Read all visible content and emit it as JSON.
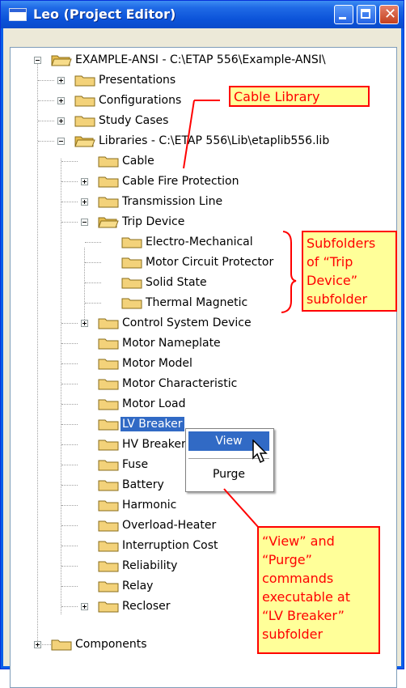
{
  "window": {
    "title": "Leo (Project Editor)",
    "buttons": [
      "minimize",
      "maximize",
      "close"
    ]
  },
  "tree": {
    "root": {
      "label": "EXAMPLE-ANSI - C:\\ETAP 556\\Example-ANSI\\",
      "expanded": true
    },
    "top_level": [
      {
        "label": "Presentations",
        "expanded": false
      },
      {
        "label": "Configurations",
        "expanded": false
      },
      {
        "label": "Study Cases",
        "expanded": false
      },
      {
        "label": "Libraries - C:\\ETAP 556\\Lib\\etaplib556.lib",
        "expanded": true
      },
      {
        "label": "Components",
        "expanded": false
      }
    ],
    "library_children": [
      {
        "label": "Cable",
        "expander": "none"
      },
      {
        "label": "Cable Fire Protection",
        "expander": "plus"
      },
      {
        "label": "Transmission Line",
        "expander": "plus"
      },
      {
        "label": "Trip Device",
        "expander": "minus"
      },
      {
        "label": "Control System Device",
        "expander": "plus"
      },
      {
        "label": "Motor Nameplate",
        "expander": "none"
      },
      {
        "label": "Motor Model",
        "expander": "none"
      },
      {
        "label": "Motor Characteristic",
        "expander": "none"
      },
      {
        "label": "Motor Load",
        "expander": "none"
      },
      {
        "label": "LV Breaker",
        "expander": "none",
        "selected": true
      },
      {
        "label": "HV Breaker",
        "expander": "none"
      },
      {
        "label": "Fuse",
        "expander": "none"
      },
      {
        "label": "Battery",
        "expander": "none"
      },
      {
        "label": "Harmonic",
        "expander": "none"
      },
      {
        "label": "Overload-Heater",
        "expander": "none"
      },
      {
        "label": "Interruption Cost",
        "expander": "none"
      },
      {
        "label": "Reliability",
        "expander": "none"
      },
      {
        "label": "Relay",
        "expander": "none"
      },
      {
        "label": "Recloser",
        "expander": "plus"
      }
    ],
    "trip_device_children": [
      {
        "label": "Electro-Mechanical"
      },
      {
        "label": "Motor Circuit Protector"
      },
      {
        "label": "Solid State"
      },
      {
        "label": "Thermal Magnetic"
      }
    ]
  },
  "context_menu": {
    "items": [
      {
        "label": "View",
        "highlighted": true
      },
      {
        "label": "Purge",
        "highlighted": false
      }
    ]
  },
  "callouts": {
    "cable_library": "Cable Library",
    "subfolders": [
      "Subfolders",
      "of “Trip",
      "Device”",
      "subfolder"
    ],
    "commands": [
      "“View” and",
      "“Purge”",
      "commands",
      "executable at",
      "“LV Breaker”",
      "subfolder"
    ]
  },
  "colors": {
    "title_bar": "#0b52d8",
    "selection": "#316ac5",
    "callout_fill": "#ffff99",
    "callout_text": "#ff0000",
    "folder": "#f3d27a"
  }
}
